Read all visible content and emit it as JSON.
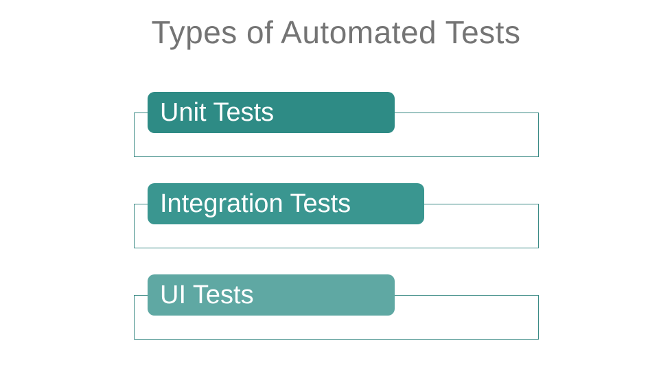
{
  "title": "Types of Automated Tests",
  "items": [
    {
      "label": "Unit Tests"
    },
    {
      "label": "Integration Tests"
    },
    {
      "label": "UI Tests"
    }
  ]
}
